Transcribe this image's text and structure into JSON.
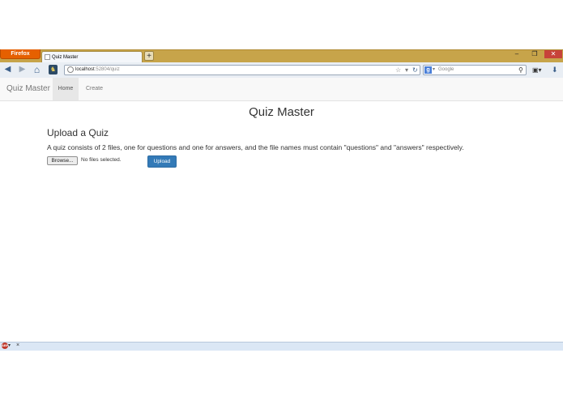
{
  "browser": {
    "menu_label": "Firefox",
    "tab_title": "Quiz Master",
    "new_tab_symbol": "+",
    "window_buttons": {
      "minimize": "–",
      "restore": "❐",
      "close": "✕"
    },
    "nav_icons": {
      "back": "◀",
      "forward": "▶",
      "home": "⌂",
      "site": "♞"
    },
    "url_host": "localhost",
    "url_rest": ":52804/quiz",
    "url_controls": {
      "bookmark_star": "☆",
      "dropdown": "▾",
      "reload": "↻"
    },
    "search_engine_glyph": "g",
    "search_placeholder": "Google",
    "search_icon": "⚲",
    "toolbar_icons": {
      "sidebar": "▣▾",
      "download": "⬇"
    },
    "addon_icon_text": "ABP",
    "addon_arrow": "▾",
    "addon_close": "×"
  },
  "navbar": {
    "brand": "Quiz Master",
    "items": [
      {
        "label": "Home",
        "active": true
      },
      {
        "label": "Create",
        "active": false
      }
    ]
  },
  "page": {
    "title": "Quiz Master",
    "section_title": "Upload a Quiz",
    "description": "A quiz consists of 2 files, one for questions and one for answers, and the file names must contain \"questions\" and \"answers\" respectively.",
    "browse_label": "Browse...",
    "file_status": "No files selected.",
    "upload_label": "Upload"
  },
  "colors": {
    "titlebar": "#c7a44a",
    "firefox_menu": "#e66000",
    "primary_button": "#337ab7",
    "navbar_bg": "#f8f8f8"
  }
}
